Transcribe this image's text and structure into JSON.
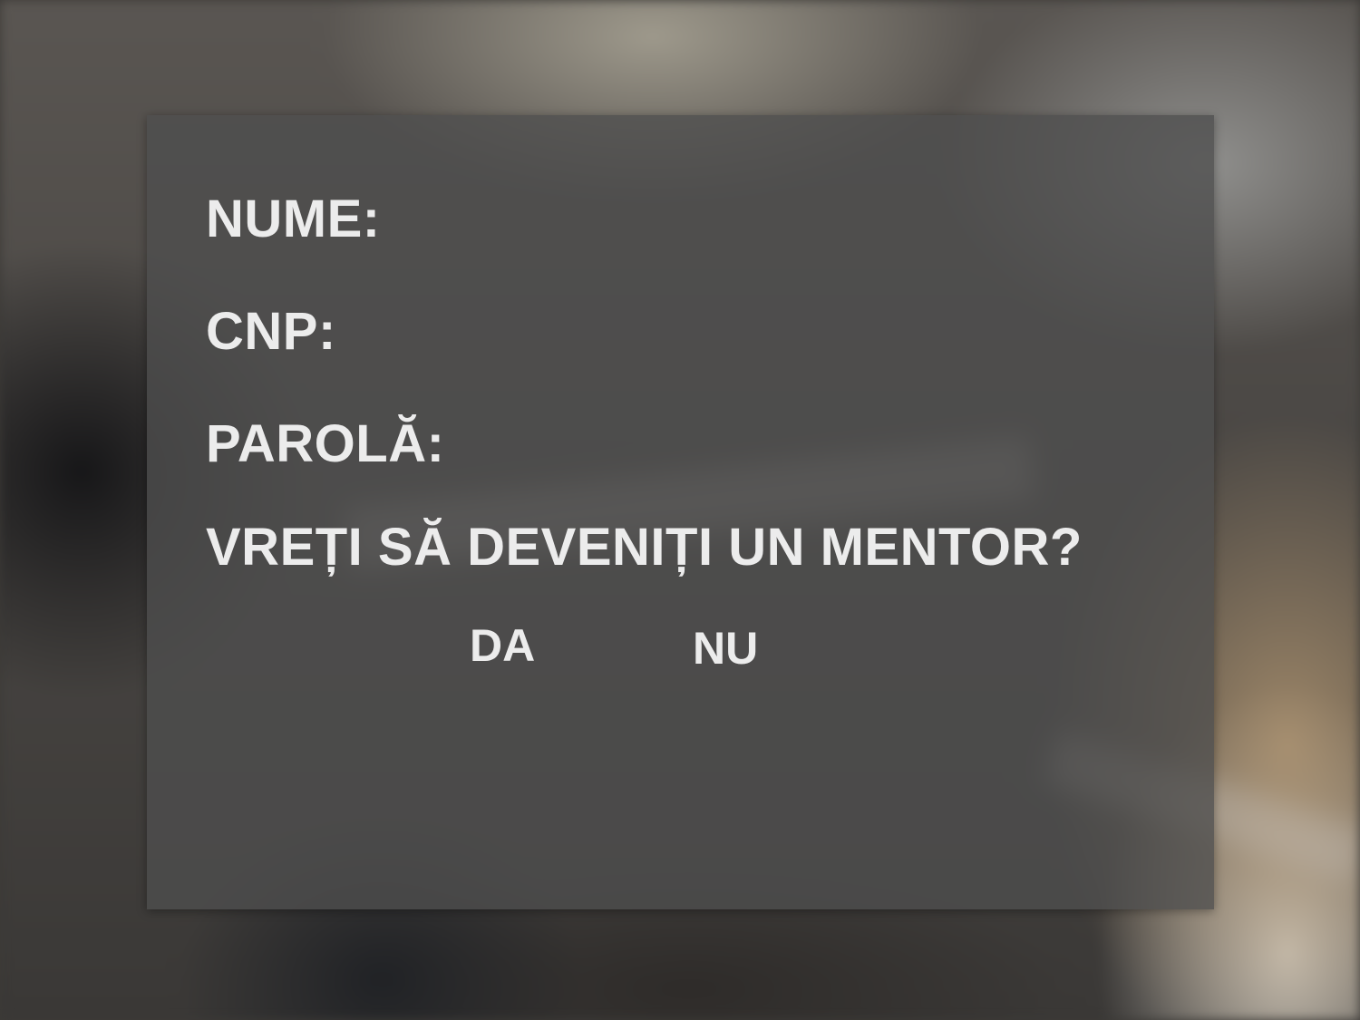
{
  "form": {
    "name_label": "NUME:",
    "cnp_label": "CNP:",
    "password_label": "PAROLĂ:",
    "mentor_question": "VREȚI SĂ DEVENIȚI UN MENTOR?",
    "yes_label": "DA",
    "no_label": "NU"
  }
}
